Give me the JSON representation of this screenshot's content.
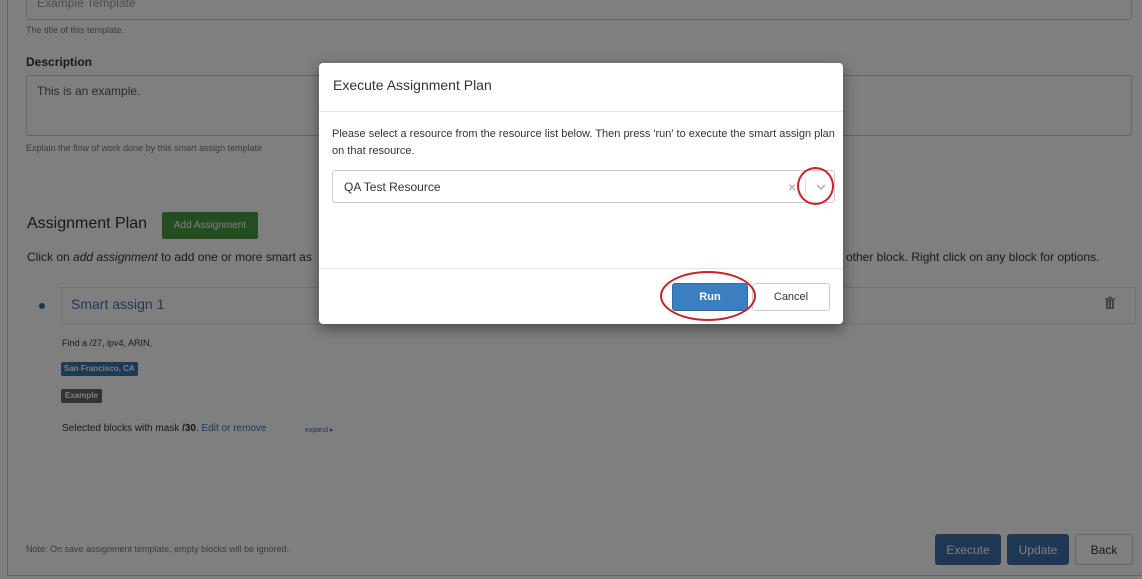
{
  "form": {
    "title_value": "Example Template",
    "title_help": "The title of this template.",
    "description_label": "Description",
    "description_value": "This is an example.",
    "description_help": "Explain the flow of work done by this smart assign template"
  },
  "assignment_plan": {
    "heading": "Assignment Plan",
    "add_button": "Add Assignment",
    "instructions_prefix": "Click on ",
    "instructions_em": "add assignment",
    "instructions_suffix": " to add one or more smart as",
    "instructions_right": "other block. Right click on any block for options.",
    "block": {
      "title": "Smart assign 1",
      "find_text": "Find a /27, ipv4, ARIN,",
      "location_tag": "San Francisco, CA",
      "example_tag": "Example",
      "selected_prefix": "Selected blocks with mask ",
      "selected_mask": "/30",
      "selected_dot": ". ",
      "edit_link": "Edit or remove",
      "expand_link": "expand ▸"
    }
  },
  "footer": {
    "note": "Note: On save assignment template, empty blocks will be ignored.",
    "execute_label": "Execute",
    "update_label": "Update",
    "back_label": "Back"
  },
  "modal": {
    "title": "Execute Assignment Plan",
    "body": "Please select a resource from the resource list below. Then press 'run' to execute the smart assign plan on that resource.",
    "selected_resource": "QA Test Resource",
    "clear_symbol": "×",
    "run_label": "Run",
    "cancel_label": "Cancel"
  },
  "colors": {
    "primary": "#3c6ea8",
    "success": "#4b9a44",
    "annotation": "#cc1f27"
  }
}
